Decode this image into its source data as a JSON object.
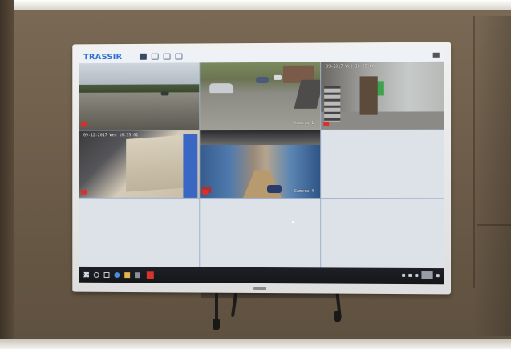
{
  "monitor": {
    "app_brand": "TRASSIR",
    "top_icons": [
      "layout-icon",
      "grid-icon",
      "settings-icon",
      "edit-icon"
    ],
    "cameras": [
      {
        "id": 1,
        "timestamp": "",
        "name": "",
        "recording": true
      },
      {
        "id": 2,
        "timestamp": "",
        "name": "Camera 1",
        "recording": false
      },
      {
        "id": 3,
        "timestamp": "09-2017 Wed 16:35:08",
        "name": "",
        "recording": true
      },
      {
        "id": 4,
        "timestamp": "09-12-2017 Wed 16:35:01",
        "name": "",
        "recording": true
      },
      {
        "id": 5,
        "timestamp": "",
        "name": "Camera 4",
        "recording": true
      }
    ],
    "empty_tiles": 4
  },
  "colors": {
    "brand_blue": "#2f6fcf",
    "recording_red": "#d8302c",
    "grid_line": "#9fb0cc",
    "empty_tile": "#dde2e8",
    "taskbar": "#1e2026"
  }
}
